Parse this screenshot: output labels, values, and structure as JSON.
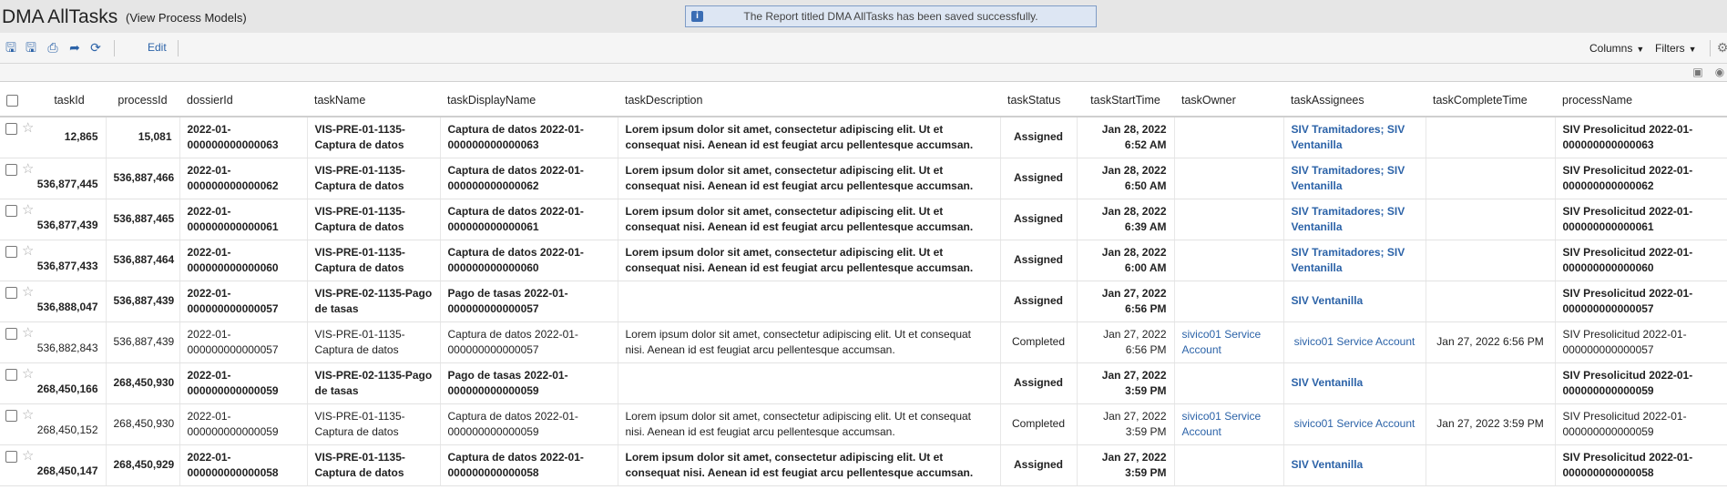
{
  "header": {
    "title": "DMA AllTasks",
    "view_link": "(View Process Models)",
    "notice": "The Report titled DMA AllTasks has been saved successfully."
  },
  "toolbar": {
    "edit": "Edit",
    "columns": "Columns",
    "filters": "Filters"
  },
  "table": {
    "columns": [
      "taskId",
      "processId",
      "dossierId",
      "taskName",
      "taskDisplayName",
      "taskDescription",
      "taskStatus",
      "taskStartTime",
      "taskOwner",
      "taskAssignees",
      "taskCompleteTime",
      "processName"
    ],
    "rows": [
      {
        "bold": true,
        "taskId": "12,865",
        "processId": "15,081",
        "dossierId": "2022-01-000000000000063",
        "taskName": "VIS-PRE-01-1135-Captura de datos",
        "taskDisplayName": "Captura de datos 2022-01-000000000000063",
        "taskDescription": "Lorem ipsum dolor sit amet, consectetur adipiscing elit. Ut et consequat nisi. Aenean id est feugiat arcu pellentesque accumsan.",
        "taskStatus": "Assigned",
        "taskStartTime": "Jan 28, 2022 6:52 AM",
        "taskOwner": "",
        "taskAssignees": "SIV Tramitadores; SIV Ventanilla",
        "taskCompleteTime": "",
        "processName": "SIV Presolicitud 2022-01-000000000000063"
      },
      {
        "bold": true,
        "taskId": "536,877,445",
        "processId": "536,887,466",
        "dossierId": "2022-01-000000000000062",
        "taskName": "VIS-PRE-01-1135-Captura de datos",
        "taskDisplayName": "Captura de datos 2022-01-000000000000062",
        "taskDescription": "Lorem ipsum dolor sit amet, consectetur adipiscing elit. Ut et consequat nisi. Aenean id est feugiat arcu pellentesque accumsan.",
        "taskStatus": "Assigned",
        "taskStartTime": "Jan 28, 2022 6:50 AM",
        "taskOwner": "",
        "taskAssignees": "SIV Tramitadores; SIV Ventanilla",
        "taskCompleteTime": "",
        "processName": "SIV Presolicitud 2022-01-000000000000062"
      },
      {
        "bold": true,
        "taskId": "536,877,439",
        "processId": "536,887,465",
        "dossierId": "2022-01-000000000000061",
        "taskName": "VIS-PRE-01-1135-Captura de datos",
        "taskDisplayName": "Captura de datos 2022-01-000000000000061",
        "taskDescription": "Lorem ipsum dolor sit amet, consectetur adipiscing elit. Ut et consequat nisi. Aenean id est feugiat arcu pellentesque accumsan.",
        "taskStatus": "Assigned",
        "taskStartTime": "Jan 28, 2022 6:39 AM",
        "taskOwner": "",
        "taskAssignees": "SIV Tramitadores; SIV Ventanilla",
        "taskCompleteTime": "",
        "processName": "SIV Presolicitud 2022-01-000000000000061"
      },
      {
        "bold": true,
        "taskId": "536,877,433",
        "processId": "536,887,464",
        "dossierId": "2022-01-000000000000060",
        "taskName": "VIS-PRE-01-1135-Captura de datos",
        "taskDisplayName": "Captura de datos 2022-01-000000000000060",
        "taskDescription": "Lorem ipsum dolor sit amet, consectetur adipiscing elit. Ut et consequat nisi. Aenean id est feugiat arcu pellentesque accumsan.",
        "taskStatus": "Assigned",
        "taskStartTime": "Jan 28, 2022 6:00 AM",
        "taskOwner": "",
        "taskAssignees": "SIV Tramitadores; SIV Ventanilla",
        "taskCompleteTime": "",
        "processName": "SIV Presolicitud 2022-01-000000000000060"
      },
      {
        "bold": true,
        "taskId": "536,888,047",
        "processId": "536,887,439",
        "dossierId": "2022-01-000000000000057",
        "taskName": "VIS-PRE-02-1135-Pago de tasas",
        "taskDisplayName": "Pago de tasas 2022-01-000000000000057",
        "taskDescription": "",
        "taskStatus": "Assigned",
        "taskStartTime": "Jan 27, 2022 6:56 PM",
        "taskOwner": "",
        "taskAssignees": "SIV Ventanilla",
        "taskCompleteTime": "",
        "processName": "SIV Presolicitud 2022-01-000000000000057"
      },
      {
        "bold": false,
        "taskId": "536,882,843",
        "processId": "536,887,439",
        "dossierId": "2022-01-000000000000057",
        "taskName": "VIS-PRE-01-1135-Captura de datos",
        "taskDisplayName": "Captura de datos 2022-01-000000000000057",
        "taskDescription": "Lorem ipsum dolor sit amet, consectetur adipiscing elit. Ut et consequat nisi. Aenean id est feugiat arcu pellentesque accumsan.",
        "taskStatus": "Completed",
        "taskStartTime": "Jan 27, 2022 6:56 PM",
        "taskOwner": "sivico01 Service Account",
        "taskAssignees": "sivico01 Service Account",
        "taskCompleteTime": "Jan 27, 2022 6:56 PM",
        "processName": "SIV Presolicitud 2022-01-000000000000057"
      },
      {
        "bold": true,
        "taskId": "268,450,166",
        "processId": "268,450,930",
        "dossierId": "2022-01-000000000000059",
        "taskName": "VIS-PRE-02-1135-Pago de tasas",
        "taskDisplayName": "Pago de tasas 2022-01-000000000000059",
        "taskDescription": "",
        "taskStatus": "Assigned",
        "taskStartTime": "Jan 27, 2022 3:59 PM",
        "taskOwner": "",
        "taskAssignees": "SIV Ventanilla",
        "taskCompleteTime": "",
        "processName": "SIV Presolicitud 2022-01-000000000000059"
      },
      {
        "bold": false,
        "taskId": "268,450,152",
        "processId": "268,450,930",
        "dossierId": "2022-01-000000000000059",
        "taskName": "VIS-PRE-01-1135-Captura de datos",
        "taskDisplayName": "Captura de datos 2022-01-000000000000059",
        "taskDescription": "Lorem ipsum dolor sit amet, consectetur adipiscing elit. Ut et consequat nisi. Aenean id est feugiat arcu pellentesque accumsan.",
        "taskStatus": "Completed",
        "taskStartTime": "Jan 27, 2022 3:59 PM",
        "taskOwner": "sivico01 Service Account",
        "taskAssignees": "sivico01 Service Account",
        "taskCompleteTime": "Jan 27, 2022 3:59 PM",
        "processName": "SIV Presolicitud 2022-01-000000000000059"
      },
      {
        "bold": true,
        "taskId": "268,450,147",
        "processId": "268,450,929",
        "dossierId": "2022-01-000000000000058",
        "taskName": "VIS-PRE-01-1135-Captura de datos",
        "taskDisplayName": "Captura de datos 2022-01-000000000000058",
        "taskDescription": "Lorem ipsum dolor sit amet, consectetur adipiscing elit. Ut et consequat nisi. Aenean id est feugiat arcu pellentesque accumsan.",
        "taskStatus": "Assigned",
        "taskStartTime": "Jan 27, 2022 3:59 PM",
        "taskOwner": "",
        "taskAssignees": "SIV Ventanilla",
        "taskCompleteTime": "",
        "processName": "SIV Presolicitud 2022-01-000000000000058"
      }
    ]
  }
}
